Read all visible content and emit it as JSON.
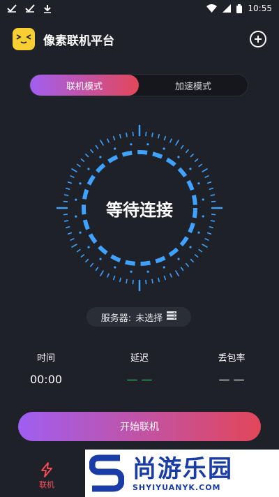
{
  "status_bar": {
    "time": "10:55"
  },
  "header": {
    "title": "像素联机平台"
  },
  "modes": [
    {
      "label": "联机模式",
      "active": true
    },
    {
      "label": "加速模式",
      "active": false
    }
  ],
  "dial": {
    "status_text": "等待连接",
    "accent_color": "#3fa2ff"
  },
  "server": {
    "label": "服务器:",
    "value": "未选择"
  },
  "stats": [
    {
      "label": "时间",
      "value": "00:00",
      "color": "#ffffff"
    },
    {
      "label": "延迟",
      "value": "— —",
      "color": "#2ecc71"
    },
    {
      "label": "丢包率",
      "value": "— —",
      "color": "#ffffff"
    }
  ],
  "actions": {
    "start_label": "开始联机"
  },
  "bottom_nav": {
    "items": [
      {
        "label": "联机",
        "active": true,
        "color": "#ff4d5b"
      }
    ]
  },
  "watermark": {
    "cn": "尚游乐园",
    "en": "SHYIYUANYK.COM"
  }
}
